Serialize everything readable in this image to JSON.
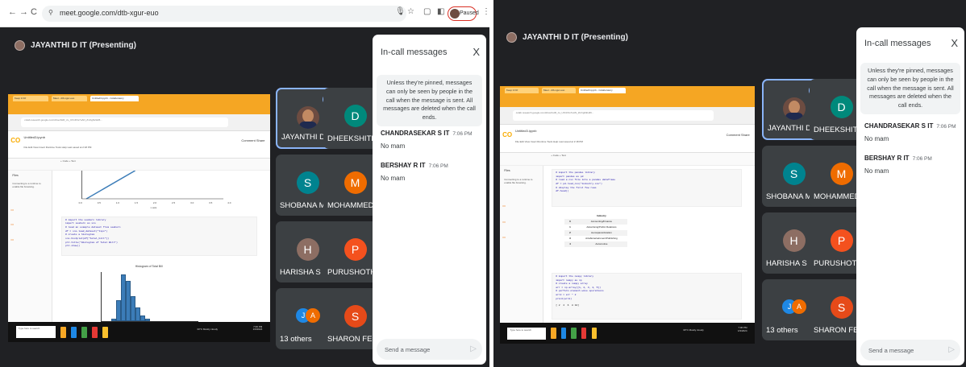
{
  "browser": {
    "url": "meet.google.com/dtb-xgur-euo",
    "nav_back": "←",
    "nav_forward": "→",
    "nav_reload": "C",
    "profile_status": "Paused"
  },
  "meeting": {
    "presenter_header": "JAYANTHI D IT (Presenting)",
    "participants": [
      {
        "name": "JAYANTHI D IT",
        "initial": "",
        "color": "#6d4c41",
        "speaking": true,
        "photo": true
      },
      {
        "name": "DHEEKSHITH...",
        "initial": "D",
        "color": "#00897b",
        "speaking": false,
        "photo": false
      },
      {
        "name": "SHOBANA M IT",
        "initial": "S",
        "color": "#00838f",
        "speaking": false,
        "photo": false
      },
      {
        "name": "MOHAMMED ...",
        "initial": "M",
        "color": "#ef6c00",
        "speaking": false,
        "photo": false
      },
      {
        "name": "HARISHA S IT",
        "initial": "H",
        "color": "#8d6e63",
        "speaking": false,
        "photo": false
      },
      {
        "name": "PURUSHOTHA...",
        "initial": "P",
        "color": "#f4511e",
        "speaking": false,
        "photo": false
      },
      {
        "name": "13 others",
        "initial": "",
        "color": "#3c4043",
        "speaking": false,
        "photo": false,
        "others": [
          "J",
          "A"
        ]
      },
      {
        "name": "SHARON FEMI...",
        "initial": "S",
        "color": "#e64a19",
        "speaking": false,
        "photo": false
      }
    ]
  },
  "chat": {
    "title": "In-call messages",
    "close": "X",
    "notice": "Unless they're pinned, messages can only be seen by people in the call when the message is sent. All messages are deleted when the call ends.",
    "messages": [
      {
        "sender": "CHANDRASEKAR S IT",
        "time": "7:06 PM",
        "text": "No mam"
      },
      {
        "sender": "BERSHAY R IT",
        "time": "7:06 PM",
        "text": "No mam"
      }
    ],
    "input_placeholder": "Send a message"
  },
  "shared": {
    "tabs": [
      "Keep it Fit!",
      "Meet - dtb-xgur-euo",
      "Untitled3.ipynb - Colaboratory"
    ],
    "address": "colab.research.google.com/drive/1HR_zu_UXnFKs7uAN_ZmhgN2H26...",
    "notebook_title": "Untitled3.ipynb",
    "menu": "File  Edit  View  Insert  Runtime  Tools  Help  Last saved at 2:18 PM",
    "toolbar": "+ Code   + Text",
    "files_label": "Files",
    "files_msg": "Connecting to a runtime to enable file browsing.",
    "share_right": "Comment   Share",
    "left_code": "# import the seaborn library\nimport seaborn as sns\n# load an example dataset from seaborn\ndf = sns.load_dataset(\"tips\")\n# create a histogram\nsns.histplot(df[\"total_bill\"])\nplt.title(\"Histogram of Total Bill\")\nplt.show()",
    "plot_title": "Histogram of Total Bill",
    "x_label": "x axis",
    "x_ticks": [
      "0.0",
      "0.5",
      "1.0",
      "1.5",
      "2.0",
      "2.5",
      "3.0",
      "3.5",
      "4.0"
    ],
    "right_code1": "# import the pandas library\nimport pandas as pd\n# read a csv file into a pandas dataframe\ndf = pd.read_csv(\"industry.csv\")\n# display the first few rows\ndf.head()",
    "df_header": "Industry",
    "df_rows": [
      {
        "i": "0",
        "v": "Accounting/Finance"
      },
      {
        "i": "1",
        "v": "Advertising/Public Relations"
      },
      {
        "i": "2",
        "v": "Aerospace/Aviation"
      },
      {
        "i": "3",
        "v": "Arts/Entertainment/Publishing"
      },
      {
        "i": "4",
        "v": "Automotive"
      }
    ],
    "right_code2": "# import the numpy library\nimport numpy as np\n# create a numpy array\narr = np.array([1, 2, 3, 4, 5])\n# perform element-wise operations\narr2 = arr * 2\nprint(arr2)",
    "right_out": "[ 2  4  6  8 10]",
    "taskbar_search": "Type here to search",
    "weather": "30°C  Mostly cloudy",
    "clock": "7:06 PM\n1/9/2024"
  },
  "histogram": {
    "values": [
      3,
      22,
      48,
      41,
      26,
      14,
      6,
      3
    ],
    "ylim": [
      0,
      50
    ]
  }
}
